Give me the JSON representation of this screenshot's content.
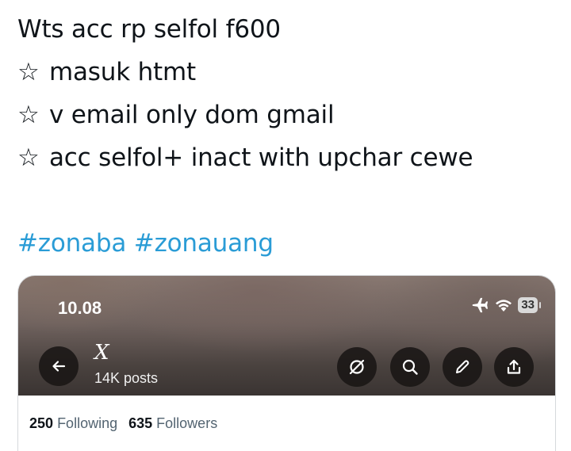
{
  "tweet": {
    "line1": "Wts acc rp selfol f600",
    "bullet_symbol": "☆",
    "line2": "masuk htmt",
    "line3": "v email only dom gmail",
    "line4": "acc selfol+ inact with upchar cewe",
    "hashtags": [
      "#zonaba",
      "#zonauang"
    ]
  },
  "screenshot": {
    "status_bar": {
      "time": "10.08",
      "battery": "33"
    },
    "profile": {
      "title": "X",
      "posts": "14K posts"
    },
    "stats": {
      "following_count": "250",
      "following_label": "Following",
      "followers_count": "635",
      "followers_label": "Followers"
    }
  }
}
